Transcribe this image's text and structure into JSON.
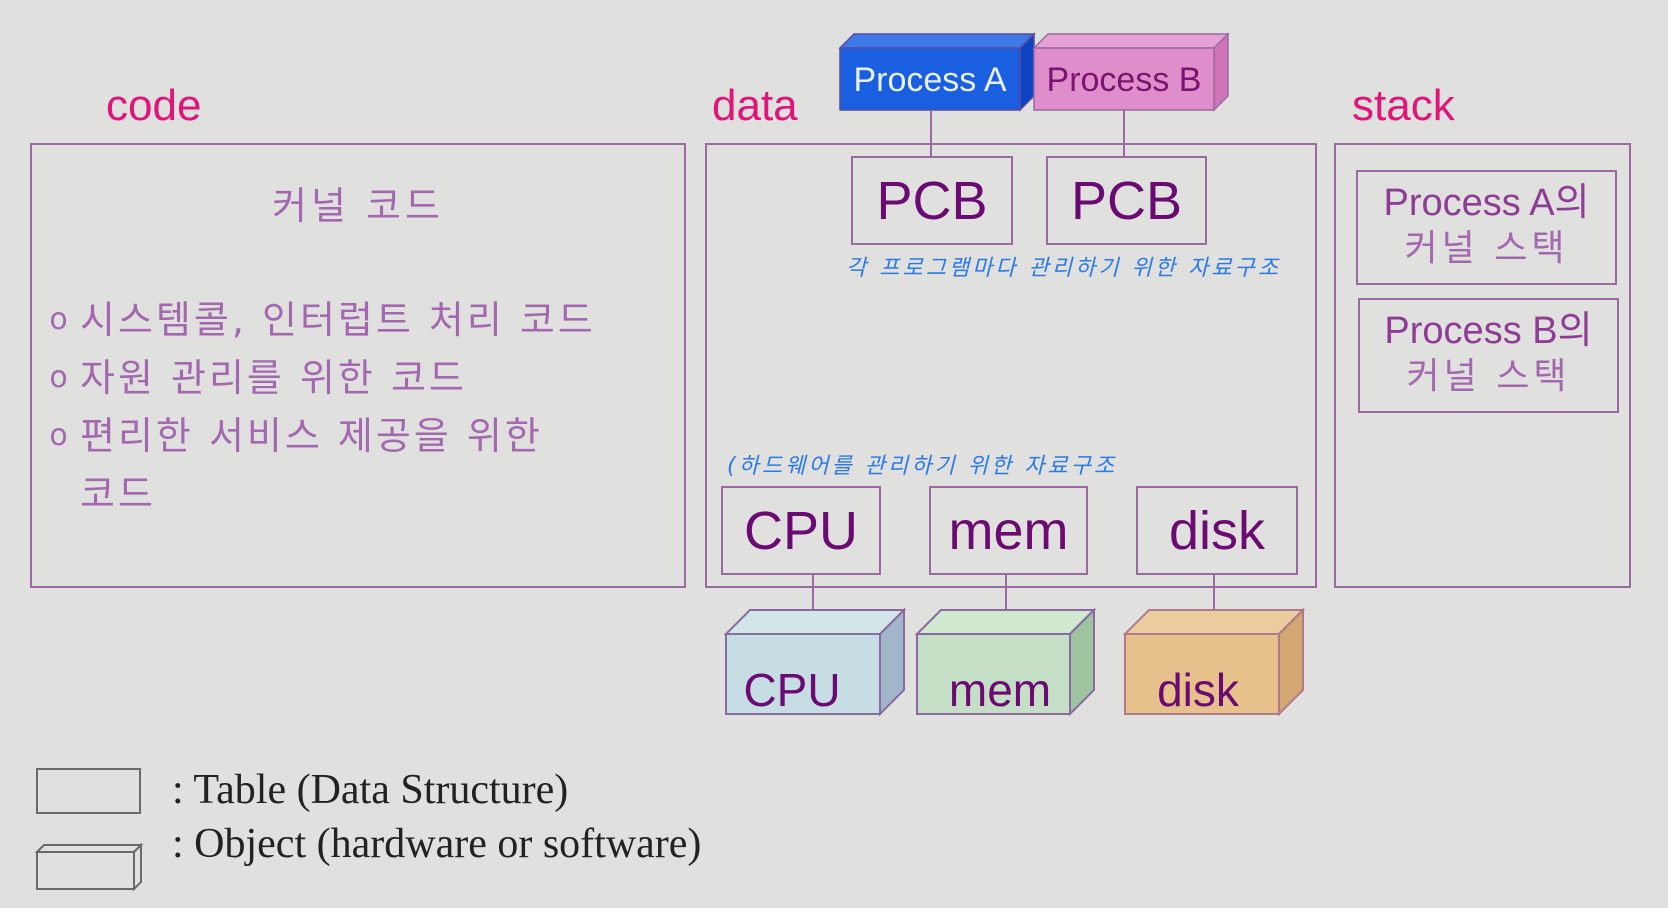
{
  "sections": {
    "code": {
      "label": "code",
      "title": "커널 코드",
      "bullets": [
        {
          "mark": "o",
          "text": "시스템콜, 인터럽트 처리 코드"
        },
        {
          "mark": "o",
          "text": "자원 관리를 위한 코드"
        },
        {
          "mark": "o",
          "text": "편리한 서비스 제공을 위한"
        },
        {
          "mark": "",
          "text": "코드"
        }
      ]
    },
    "data": {
      "label": "data",
      "processes": [
        {
          "label": "Process A",
          "color": "#1a5fe0",
          "side": "#0c44c2",
          "top": "#3d7ae8",
          "text_color": "#e8f0ff"
        },
        {
          "label": "Process B",
          "color": "#e08ecb",
          "side": "#cf74b8",
          "top": "#e6a2d4",
          "text_color": "#7a1470"
        }
      ],
      "pcbs": [
        "PCB",
        "PCB"
      ],
      "pcb_note": "각 프로그램마다 관리하기 위한 자료구조",
      "hardware_note": "하드웨어를 관리하기 위한 자료구조",
      "hardware_tables": [
        "CPU",
        "mem",
        "disk"
      ],
      "hardware_objects": [
        {
          "label": "CPU",
          "color": "#c6dde3",
          "side": "#a2b6cb",
          "top": "#d2e6ea"
        },
        {
          "label": "mem",
          "color": "#c4dfc6",
          "side": "#9ec59f",
          "top": "#d0e8d0"
        },
        {
          "label": "disk",
          "color": "#e6c18c",
          "side": "#d2a772",
          "top": "#ebcc9e"
        }
      ]
    },
    "stack": {
      "label": "stack",
      "items": [
        {
          "line1": "Process A의",
          "line2": "커널 스택"
        },
        {
          "line1": "Process B의",
          "line2": "커널 스택"
        }
      ]
    }
  },
  "legend": [
    {
      "symbol": "table",
      "text": ":  Table  (Data Structure)"
    },
    {
      "symbol": "object",
      "text": ":  Object (hardware or software)"
    }
  ],
  "colors": {
    "section_label": "#e0147a",
    "border": "#9b6aa0",
    "table_text": "#6a0a72",
    "annotation": "#2a7ae8",
    "background": "#e0e0de"
  }
}
